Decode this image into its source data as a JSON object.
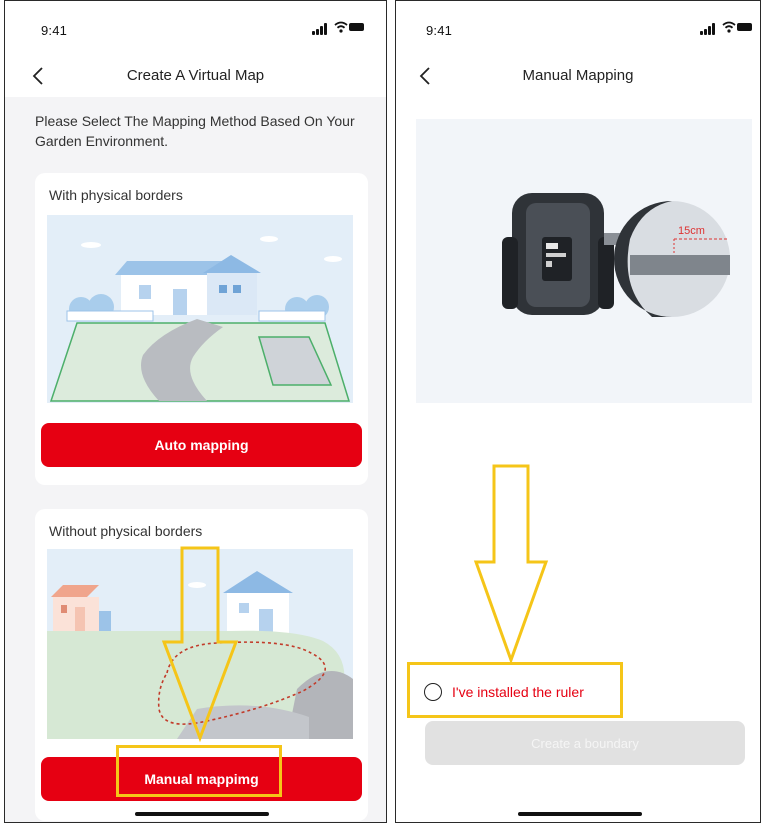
{
  "left_screen": {
    "status_time": "9:41",
    "nav_title": "Create A Virtual Map",
    "intro_text": "Please Select The Mapping Method Based On Your Garden Environment.",
    "card_physical": {
      "title": "With physical borders",
      "button_label": "Auto mapping"
    },
    "card_virtual": {
      "title": "Without physical borders",
      "button_label": "Manual mappimg"
    }
  },
  "right_screen": {
    "status_time": "9:41",
    "nav_title": "Manual Mapping",
    "ruler_label": "15cm",
    "checkbox_label": "I've installed the ruler",
    "boundary_button_label": "Create a boundary"
  },
  "colors": {
    "accent_red": "#e60012",
    "highlight_yellow": "#f5c518",
    "disabled_gray": "#e1e1e1"
  },
  "icons": {
    "back": "chevron-left-icon",
    "signal": "signal-icon",
    "wifi": "wifi-icon",
    "battery": "battery-icon"
  }
}
